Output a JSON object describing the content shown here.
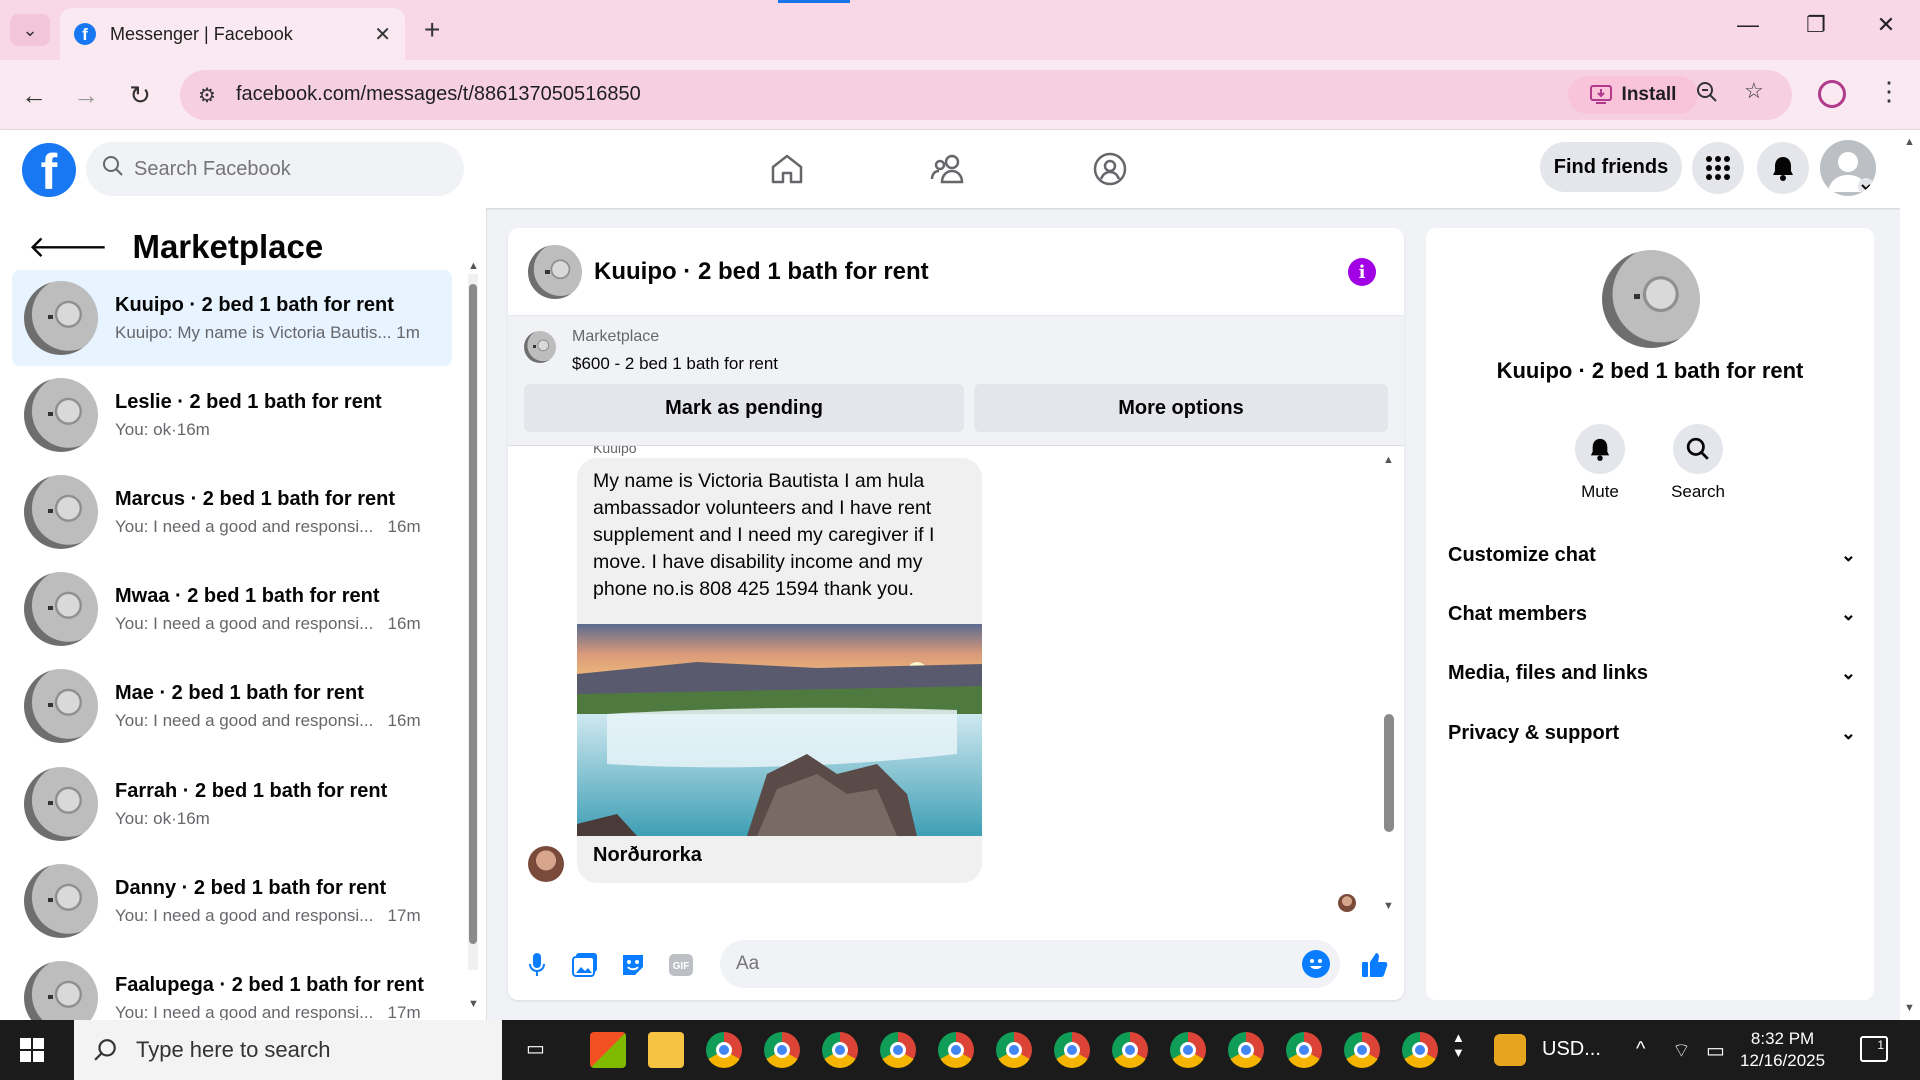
{
  "browser": {
    "tab_title": "Messenger | Facebook",
    "url": "facebook.com/messages/t/886137050516850",
    "install_label": "Install"
  },
  "fb": {
    "search_placeholder": "Search Facebook",
    "find_friends": "Find friends"
  },
  "sidebar": {
    "title": "Marketplace",
    "conversations": [
      {
        "name": "Kuuipo · 2 bed 1 bath for rent",
        "preview": "Kuuipo: My name is Victoria Bautis...",
        "time": "1m",
        "active": true
      },
      {
        "name": "Leslie · 2 bed 1 bath for rent",
        "preview": "You: ok",
        "time": "16m"
      },
      {
        "name": "Marcus · 2 bed 1 bath for rent",
        "preview": "You: I need a good and responsi...",
        "time": "16m"
      },
      {
        "name": "Mwaa · 2 bed 1 bath for rent",
        "preview": "You: I need a good and responsi...",
        "time": "16m"
      },
      {
        "name": "Mae · 2 bed 1 bath for rent",
        "preview": "You: I need a good and responsi...",
        "time": "16m"
      },
      {
        "name": "Farrah · 2 bed 1 bath for rent",
        "preview": "You: ok",
        "time": "16m"
      },
      {
        "name": "Danny · 2 bed 1 bath for rent",
        "preview": "You: I need a good and responsi...",
        "time": "17m"
      },
      {
        "name": "Faalupega · 2 bed 1 bath for rent",
        "preview": "You: I need a good and responsi...",
        "time": "17m"
      }
    ]
  },
  "chat": {
    "title": "Kuuipo · 2 bed 1 bath for rent",
    "marketplace_label": "Marketplace",
    "listing": "$600 - 2 bed 1 bath for rent",
    "mark_pending": "Mark as pending",
    "more_options": "More options",
    "sender": "Kuuipo",
    "message": "My name is Victoria Bautista I am hula ambassador volunteers and I have rent supplement and I need my caregiver if I move. I have disability income and my phone no.is 808 425 1594 thank you.",
    "attachment_caption": "Norðurorka",
    "composer_placeholder": "Aa"
  },
  "info_panel": {
    "name": "Kuuipo · 2 bed 1 bath for rent",
    "mute": "Mute",
    "search": "Search",
    "sections": [
      "Customize chat",
      "Chat members",
      "Media, files and links",
      "Privacy & support"
    ]
  },
  "taskbar": {
    "search_placeholder": "Type here to search",
    "tray_label": "USD...",
    "time": "8:32 PM",
    "date": "12/16/2025",
    "notification_count": "1"
  },
  "colors": {
    "fb_blue": "#1877f2",
    "active_conv": "#e7f3ff",
    "info_purple": "#a100e6",
    "tab_pink": "#f8d7e6"
  }
}
